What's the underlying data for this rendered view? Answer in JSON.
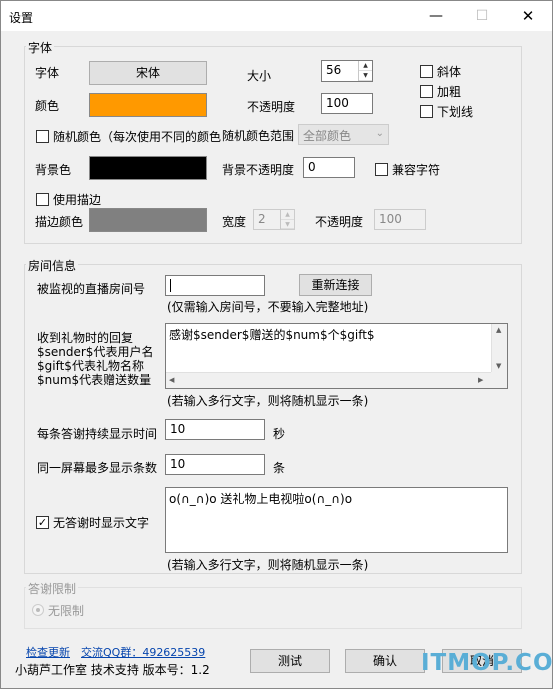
{
  "window": {
    "title": "设置",
    "min_glyph": "—",
    "max_glyph": "☐",
    "close_glyph": "✕"
  },
  "font_group": {
    "label": "字体",
    "font_label": "字体",
    "font_button": "宋体",
    "size_label": "大小",
    "size_value": "56",
    "italic": "斜体",
    "bold": "加粗",
    "underline": "下划线",
    "color_label": "颜色",
    "color_value": "#ff9900",
    "opacity_label": "不透明度",
    "opacity_value": "100",
    "random_color": "随机颜色（每次使用不同的颜色",
    "random_range_label": "随机颜色范围",
    "random_range_value": "全部颜色",
    "bg_label": "背景色",
    "bg_color": "#000000",
    "bg_opacity_label": "背景不透明度",
    "bg_opacity_value": "0",
    "compat_chars": "兼容字符",
    "use_stroke": "使用描边",
    "stroke_color_label": "描边颜色",
    "stroke_color": "#808080",
    "width_label": "宽度",
    "width_value": "2",
    "stroke_opacity_label": "不透明度",
    "stroke_opacity_value": "100"
  },
  "room_group": {
    "label": "房间信息",
    "room_id_label": "被监视的直播房间号",
    "room_id_value": "",
    "reconnect_button": "重新连接",
    "room_hint": "(仅需输入房间号，不要输入完整地址)",
    "gift_reply_label_1": "收到礼物时的回复",
    "gift_reply_label_2": "$sender$代表用户名",
    "gift_reply_label_3": "$gift$代表礼物名称",
    "gift_reply_label_4": "$num$代表赠送数量",
    "gift_reply_text": "感谢$sender$赠送的$num$个$gift$",
    "multiline_hint_1": "(若输入多行文字，则将随机显示一条)",
    "duration_label": "每条答谢持续显示时间",
    "duration_value": "10",
    "duration_unit": "秒",
    "max_count_label": "同一屏幕最多显示条数",
    "max_count_value": "10",
    "max_count_unit": "条",
    "idle_text_label": "无答谢时显示文字",
    "idle_text_checked": "✓",
    "idle_text": "o(∩_∩)o 送礼物上电视啦o(∩_∩)o",
    "multiline_hint_2": "(若输入多行文字，则将随机显示一条)"
  },
  "limit_group": {
    "label": "答谢限制",
    "unlimited": "无限制"
  },
  "footer": {
    "check_update": "检查更新",
    "qq_group": "交流QQ群：492625539",
    "support": "小葫芦工作室 技术支持 版本号：1.2",
    "test_button": "测试",
    "ok_button": "确认",
    "cancel_button": "取消"
  },
  "watermark": "ITMOP.COM"
}
